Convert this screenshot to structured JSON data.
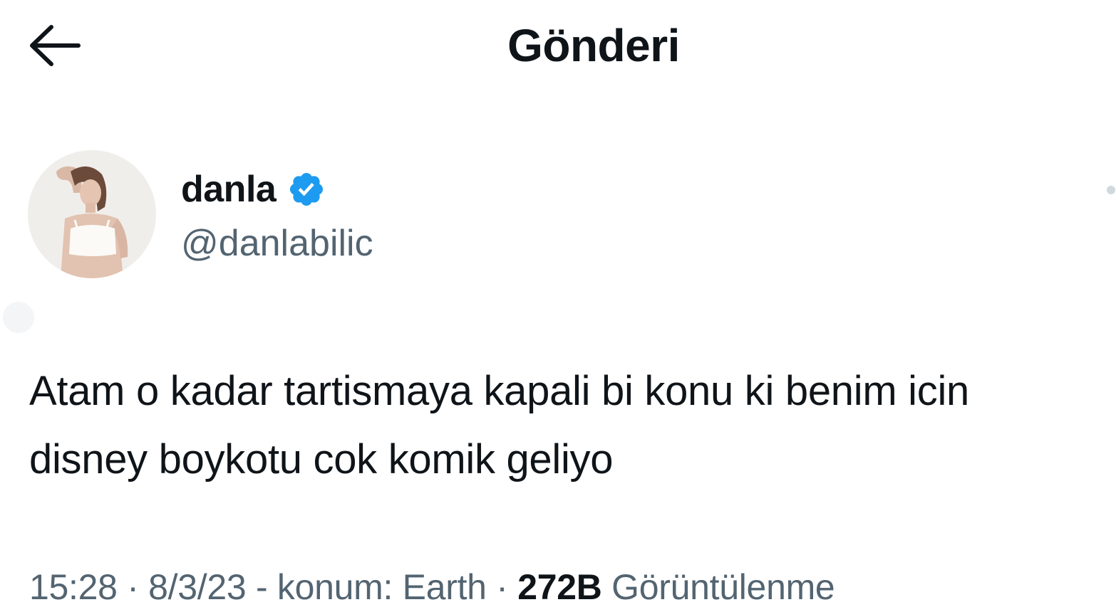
{
  "header": {
    "title": "Gönderi",
    "back_icon": "arrow-left-icon"
  },
  "tweet": {
    "author": {
      "display_name": "danla",
      "handle": "@danlabilic",
      "verified": true,
      "verified_color": "#1d9bf0",
      "avatar_icon": "profile-photo"
    },
    "text": "Atam o kadar tartismaya kapali bi konu ki benim icin disney boykotu cok komik geliyo",
    "meta": {
      "time": "15:28",
      "sep1": " · ",
      "date": "8/3/23",
      "location": " - konum: Earth",
      "sep2": " · ",
      "views_count": "272B",
      "views_label": " Görüntülenme"
    }
  },
  "colors": {
    "text_primary": "#0f1419",
    "text_secondary": "#536471",
    "accent": "#1d9bf0",
    "background": "#ffffff"
  }
}
